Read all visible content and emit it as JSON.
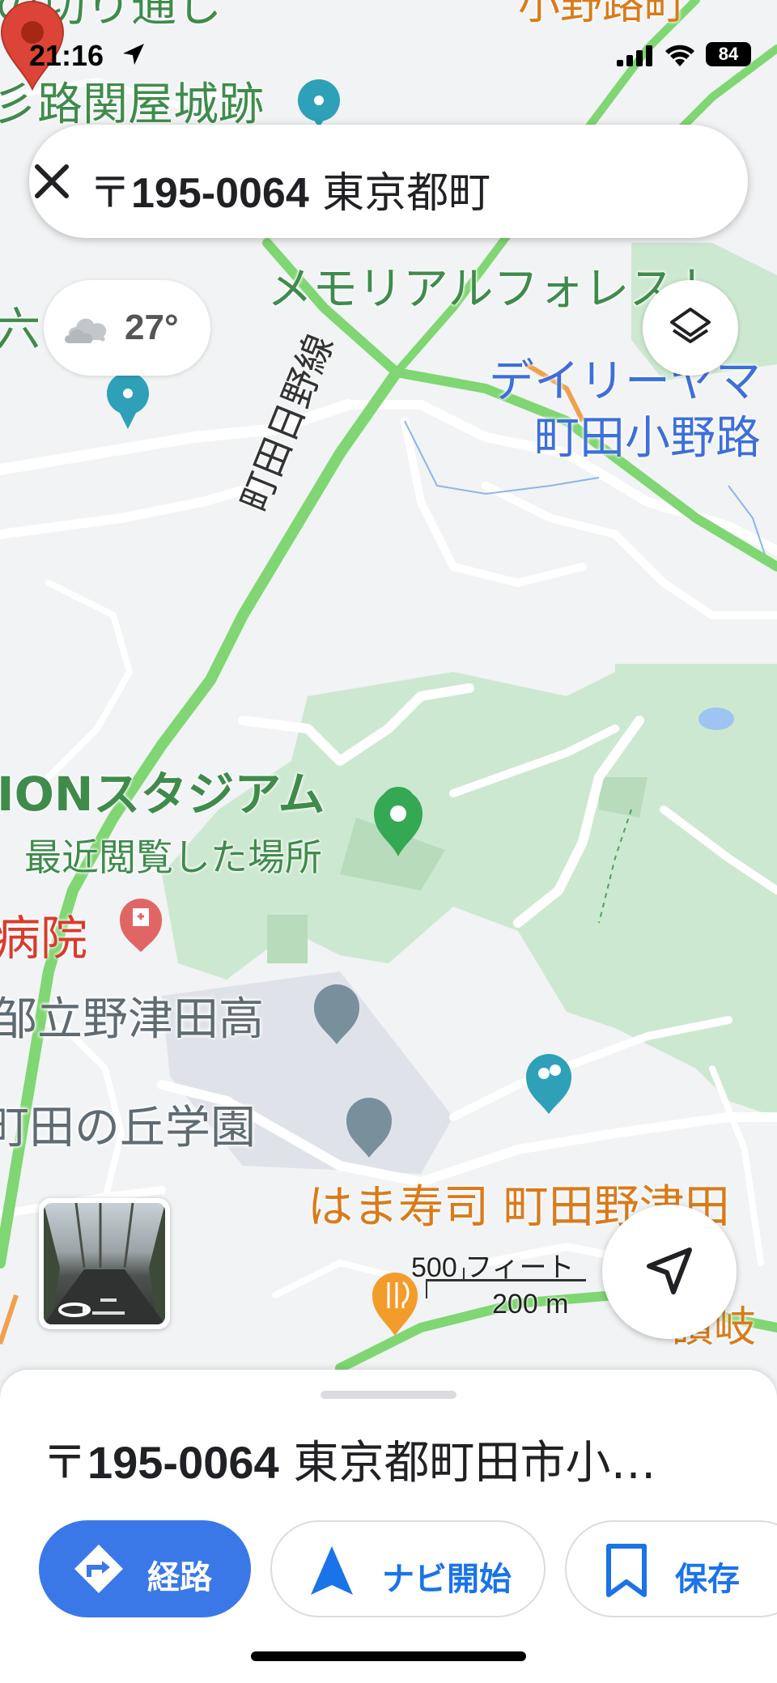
{
  "status_bar": {
    "time": "21:16",
    "battery": "84"
  },
  "search": {
    "query_prefix": "〒",
    "query_code": "195-0064",
    "query_rest": " 東京都町"
  },
  "weather": {
    "temperature": "27°",
    "icon": "cloudy-icon"
  },
  "map_labels": {
    "top_partial_1": "の切り通し",
    "top_partial_2": "彡路関屋城跡",
    "top_right_partial": "小野路町",
    "memorial_forest": "メモリアルフォレスト",
    "left_partial": "六",
    "daily_yamazaki_1": "デイリーヤマ",
    "daily_yamazaki_2": "町田小野路",
    "road_name": "町田日野線",
    "stadium": "IONスタジアム",
    "recently_viewed": "最近閲覧した場所",
    "hospital": "病院",
    "high_school": "邹立野津田高",
    "gakuen": "町田の丘学園",
    "hamazushi": "はま寿司 町田野津田",
    "sanuki": "讃岐"
  },
  "scale": {
    "feet": "500 フィート",
    "meters": "200 m"
  },
  "place_sheet": {
    "address_prefix": "〒",
    "address_code": "195-0064",
    "address_rest": " 東京都町田市小…",
    "buttons": {
      "route": "経路",
      "navigate": "ナビ開始",
      "save": "保存"
    }
  },
  "colors": {
    "accent_blue": "#3b78e7",
    "pin_red": "#db4437",
    "park_green": "#c8e6c9",
    "road_green": "#7fd672"
  }
}
